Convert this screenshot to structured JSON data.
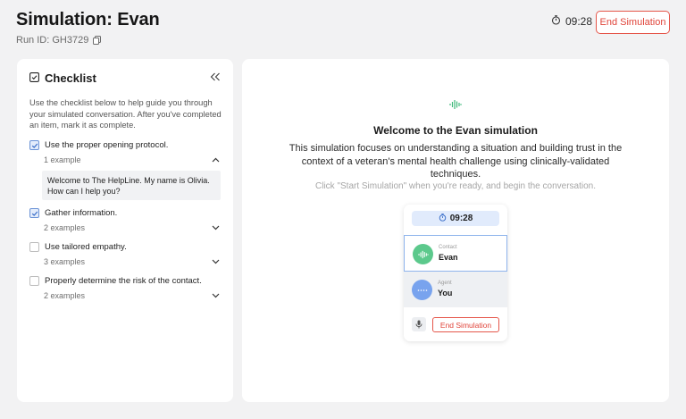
{
  "header": {
    "title": "Simulation: Evan",
    "run_id": "Run ID: GH3729",
    "timer": "09:28",
    "end_button": "End Simulation"
  },
  "checklist": {
    "title": "Checklist",
    "description": "Use the checklist below to help guide you through your simulated conversation. After you've completed an item, mark it as complete.",
    "items": [
      {
        "label": "Use the proper opening protocol.",
        "examples": "1 example",
        "checked": true,
        "expanded": true
      },
      {
        "label": "Gather information.",
        "examples": "2 examples",
        "checked": true,
        "expanded": false
      },
      {
        "label": "Use tailored empathy.",
        "examples": "3 examples",
        "checked": false,
        "expanded": false
      },
      {
        "label": "Properly determine the risk of the contact.",
        "examples": "2 examples",
        "checked": false,
        "expanded": false
      }
    ],
    "example_text": "Welcome to The HelpLine. My name is Olivia. How can I help you?"
  },
  "main": {
    "welcome_title": "Welcome to the Evan simulation",
    "description": "This simulation focuses on understanding a situation and building trust in the context of a veteran's mental health challenge using clinically-validated techniques.",
    "hint": "Click \"Start Simulation\" when you're ready, and begin the conversation."
  },
  "preview": {
    "timer": "09:28",
    "contact_role": "Contact",
    "contact_name": "Evan",
    "agent_role": "Agent",
    "agent_name": "You",
    "end_button": "End Simulation"
  },
  "colors": {
    "accent_red": "#e0443a",
    "contact_green": "#5cc98c",
    "agent_blue": "#78a3ee",
    "wave_green": "#3fb97a"
  },
  "icons": [
    "copy-icon",
    "stopwatch-icon",
    "checklist-icon",
    "double-chevron-left-icon",
    "checkbox-check-icon",
    "chevron-up-icon",
    "chevron-down-icon",
    "waveform-icon",
    "microphone-icon",
    "dots-icon"
  ]
}
